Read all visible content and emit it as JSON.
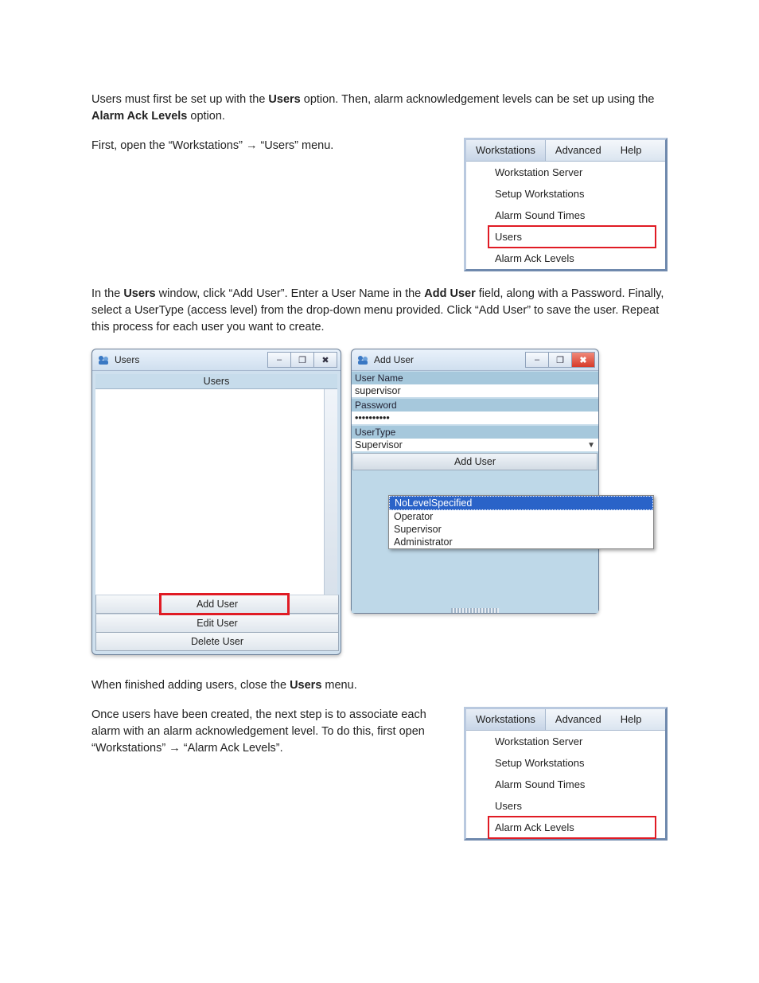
{
  "para1": {
    "seg1": "Users must first be set up with the ",
    "bold1": "Users",
    "seg2": " option. Then, alarm acknowledgement levels can be set up using the ",
    "bold2": "Alarm Ack Levels",
    "seg3": " option."
  },
  "para2": {
    "seg1": "First, open the “Workstations” ",
    "arrow": "→",
    "seg2": " “Users” menu."
  },
  "menu1": {
    "tabs": {
      "workstations": "Workstations",
      "advanced": "Advanced",
      "help": "Help"
    },
    "items": {
      "wsrv": "Workstation Server",
      "setup": "Setup Workstations",
      "ast": "Alarm Sound Times",
      "users": "Users",
      "aack": "Alarm Ack Levels"
    }
  },
  "para3": {
    "seg1": "In the ",
    "bold1": "Users",
    "seg2": " window, click “Add User”. Enter a User Name in the ",
    "bold2": "Add User",
    "seg3": " field, along with a Password. Finally, select a UserType (access level) from the drop-down menu provided. Click “Add User” to save the user. Repeat this process for each user you want to create."
  },
  "usersWin": {
    "title": "Users",
    "column": "Users",
    "buttons": {
      "add": "Add User",
      "edit": "Edit User",
      "del": "Delete User"
    }
  },
  "addUserWin": {
    "title": "Add User",
    "labels": {
      "uname": "User Name",
      "pwd": "Password",
      "utype": "UserType"
    },
    "values": {
      "uname": "supervisor",
      "pwd": "••••••••••",
      "utype": "Supervisor"
    },
    "submit": "Add User",
    "options": {
      "nolevel": "NoLevelSpecified",
      "op": "Operator",
      "sup": "Supervisor",
      "admin": "Administrator"
    }
  },
  "winbtns": {
    "min": "–",
    "max": "❐",
    "close": "✖"
  },
  "para4": {
    "seg1": "When finished adding users, close the ",
    "bold1": "Users",
    "seg2": " menu."
  },
  "para5": {
    "seg1": "Once users have been created, the next step is to associate each alarm with an alarm acknowledgement level. To do this, first open “Workstations” ",
    "arrow": "→",
    "seg2": " “Alarm Ack Levels”."
  },
  "menu2": {
    "tabs": {
      "workstations": "Workstations",
      "advanced": "Advanced",
      "help": "Help"
    },
    "items": {
      "wsrv": "Workstation Server",
      "setup": "Setup Workstations",
      "ast": "Alarm Sound Times",
      "users": "Users",
      "aack": "Alarm Ack Levels"
    }
  }
}
